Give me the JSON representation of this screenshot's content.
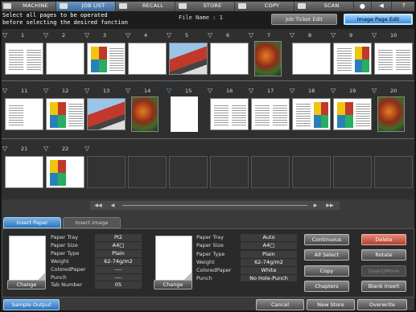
{
  "nav": {
    "tabs": [
      {
        "label": "MACHINE",
        "icon": "machine-icon"
      },
      {
        "label": "JOB LIST",
        "icon": "job-list-icon"
      },
      {
        "label": "RECALL",
        "icon": "recall-icon"
      },
      {
        "label": "STORE",
        "icon": "store-icon"
      },
      {
        "label": "COPY",
        "icon": "copy-icon"
      },
      {
        "label": "SCAN",
        "icon": "scan-icon"
      }
    ],
    "active": "JOB LIST"
  },
  "header": {
    "message_line1": "Select all pages to be operated",
    "message_line2": "before selecting the desired function",
    "file_name": "File Name : 1",
    "job_ticket_edit": "Job Ticket Edit",
    "image_page_edit": "Image Page Edit"
  },
  "pages": {
    "row1": [
      "1",
      "2",
      "3",
      "4",
      "5",
      "6",
      "7",
      "8",
      "9",
      "10"
    ],
    "row2": [
      "11",
      "12",
      "13",
      "14",
      "15",
      "16",
      "17",
      "18",
      "19",
      "20"
    ],
    "row3": [
      "21",
      "22"
    ]
  },
  "bottom_tabs": {
    "insert_paper": "Insert Paper",
    "insert_image": "Insert Image"
  },
  "left_paper": {
    "rows": [
      {
        "k": "Paper Tray",
        "v": "PI2"
      },
      {
        "k": "Paper Size",
        "v": "A4□"
      },
      {
        "k": "Paper Type",
        "v": "Plain"
      },
      {
        "k": "Weight",
        "v": "62-74g/m2"
      },
      {
        "k": "ColoredPaper",
        "v": "----"
      },
      {
        "k": "Punch",
        "v": "----"
      },
      {
        "k": "Tab Number",
        "v": "05"
      }
    ],
    "change": "Change"
  },
  "right_paper": {
    "rows": [
      {
        "k": "Paper Tray",
        "v": "Auto"
      },
      {
        "k": "Paper Size",
        "v": "A4□"
      },
      {
        "k": "",
        "v": ""
      },
      {
        "k": "Paper Type",
        "v": "Plain"
      },
      {
        "k": "Weight",
        "v": "62-74g/m2"
      },
      {
        "k": "ColoredPaper",
        "v": "White"
      },
      {
        "k": "Punch",
        "v": "No Hole-Punch"
      }
    ],
    "change": "Change"
  },
  "actions": {
    "continuous": "Continuous",
    "delete": "Delete",
    "all_select": "All Select",
    "rotate": "Rotate",
    "copy": "Copy",
    "insert_move": "Insert/Move",
    "chapters": "Chapters",
    "blank_insert": "Blank Insert"
  },
  "footer": {
    "sample_output": "Sample Output",
    "cancel": "Cancel",
    "new_store": "New Store",
    "overwrite": "Overwrite"
  },
  "colors": {
    "accent": "#3a8fe0",
    "delete": "#b04030",
    "panel": "#2a2a2a"
  }
}
